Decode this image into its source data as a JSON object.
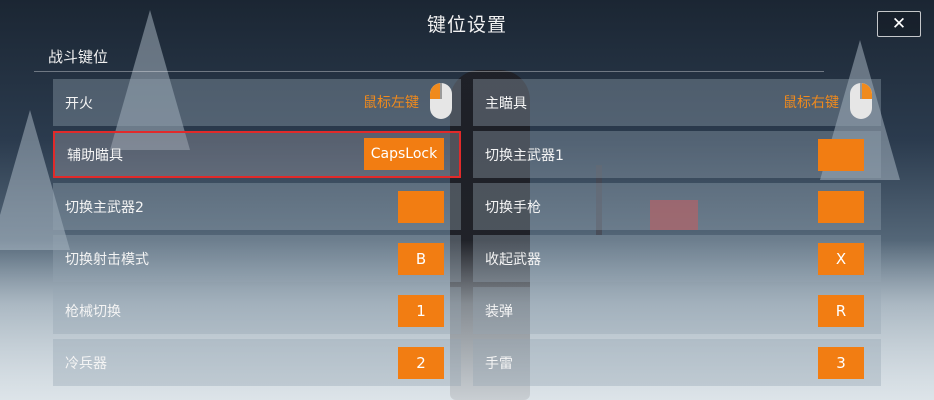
{
  "header": {
    "title": "键位设置",
    "close_icon": "✕"
  },
  "section": {
    "title": "战斗键位"
  },
  "left_column": [
    {
      "label": "开火",
      "type": "mouse",
      "binding": "鼠标左键",
      "mouse_side": "left"
    },
    {
      "label": "辅助瞄具",
      "type": "key",
      "binding": "CapsLock",
      "selected": true
    },
    {
      "label": "切换主武器2",
      "type": "key",
      "binding": ""
    },
    {
      "label": "切换射击模式",
      "type": "key",
      "binding": "B"
    },
    {
      "label": "枪械切换",
      "type": "key",
      "binding": "1"
    },
    {
      "label": "冷兵器",
      "type": "key",
      "binding": "2"
    }
  ],
  "right_column": [
    {
      "label": "主瞄具",
      "type": "mouse",
      "binding": "鼠标右键",
      "mouse_side": "right"
    },
    {
      "label": "切换主武器1",
      "type": "key",
      "binding": ""
    },
    {
      "label": "切换手枪",
      "type": "key",
      "binding": ""
    },
    {
      "label": "收起武器",
      "type": "key",
      "binding": "X"
    },
    {
      "label": "装弹",
      "type": "key",
      "binding": "R"
    },
    {
      "label": "手雷",
      "type": "key",
      "binding": "3"
    }
  ],
  "colors": {
    "accent": "#f27d12",
    "selected_border": "#e12a2a",
    "mouse_text": "#f08a1c"
  },
  "icons": {
    "mouse": "mouse-icon",
    "close": "close-icon"
  }
}
